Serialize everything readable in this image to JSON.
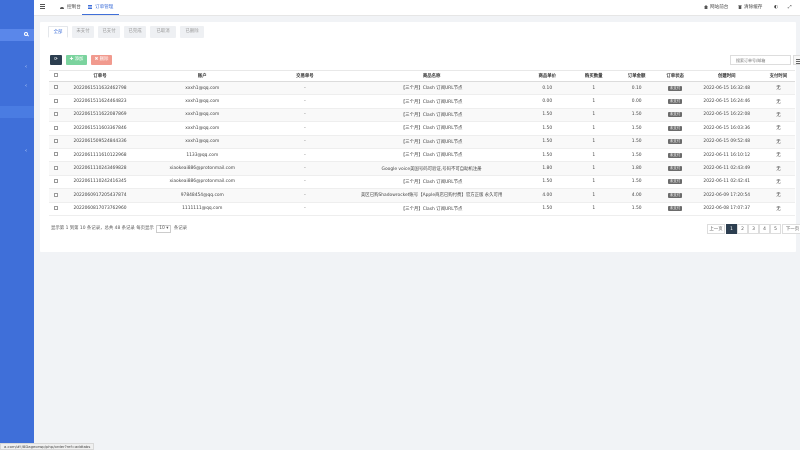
{
  "colors": {
    "sidebar": "#3f6fd9",
    "accent": "#3f6fd9",
    "dark": "#2c3e50",
    "add": "#7bd39e",
    "delete": "#f19a8e"
  },
  "topbar": {
    "tabs": [
      {
        "label": "控制台",
        "icon": "dashboard-icon"
      },
      {
        "label": "订单管理",
        "icon": "list-icon"
      }
    ],
    "right": [
      {
        "label": "网站前台",
        "icon": "home-icon"
      },
      {
        "label": "清除缓存",
        "icon": "trash-icon"
      }
    ]
  },
  "filter_tabs": [
    "全部",
    "未支付",
    "已支付",
    "已完成",
    "已取消",
    "已删除"
  ],
  "toolbar": {
    "add": "添加",
    "delete": "删除"
  },
  "search": {
    "placeholder": "搜索订单号/邮箱"
  },
  "table": {
    "headers": [
      "订单号",
      "账户",
      "交易单号",
      "商品名称",
      "商品单价",
      "购买数量",
      "订单金额",
      "订单状态",
      "创建时间",
      "支付时间"
    ],
    "rows": [
      [
        "2022061511632462798",
        "xxxh1@qq.com",
        "-",
        "【三个月】Clash 订阅URL节点",
        "0.10",
        "1",
        "0.10",
        "未支付",
        "2022-06-15 16:32:48",
        "无"
      ],
      [
        "2022061511624464823",
        "xxxh1@qq.com",
        "-",
        "【三个月】Clash 订阅URL节点",
        "0.00",
        "1",
        "0.00",
        "未支付",
        "2022-06-15 16:24:46",
        "无"
      ],
      [
        "2022061511622087869",
        "xxxh1@qq.com",
        "-",
        "【三个月】Clash 订阅URL节点",
        "1.50",
        "1",
        "1.50",
        "未支付",
        "2022-06-15 16:22:08",
        "无"
      ],
      [
        "2022061511603367846",
        "xxxh1@qq.com",
        "-",
        "【三个月】Clash 订阅URL节点",
        "1.50",
        "1",
        "1.50",
        "未支付",
        "2022-06-15 16:03:36",
        "无"
      ],
      [
        "2022061509524844336",
        "xxxh1@qq.com",
        "-",
        "【三个月】Clash 订阅URL节点",
        "1.50",
        "1",
        "1.50",
        "未支付",
        "2022-06-15 09:52:48",
        "无"
      ],
      [
        "2022061111610122968",
        "1133@qq.com",
        "-",
        "【三个月】Clash 订阅URL节点",
        "1.50",
        "1",
        "1.50",
        "未支付",
        "2022-06-11 16:10:12",
        "无"
      ],
      [
        "2022061110243469828",
        "xiaokeai886@protonmail.com",
        "-",
        "Google voice美国号码可验证,号码不可自助机注册",
        "1.80",
        "1",
        "1.80",
        "未支付",
        "2022-06-11 02:43:49",
        "无"
      ],
      [
        "2022061110242416345",
        "xiaokeai886@protonmail.com",
        "-",
        "【三个月】Clash 订阅URL节点",
        "1.50",
        "1",
        "1.50",
        "未支付",
        "2022-06-11 02:42:41",
        "无"
      ],
      [
        "2022060917205437874",
        "97848454@qq.com",
        "-",
        "美区已购Shadowrocket账号【Apple商店已购付费】官方正版 永久可用",
        "4.00",
        "1",
        "4.00",
        "未支付",
        "2022-06-09 17:20:54",
        "无"
      ],
      [
        "2022060817073762960",
        "1111111@qq.com",
        "-",
        "【三个月】Clash 订阅URL节点",
        "1.50",
        "1",
        "1.50",
        "未支付",
        "2022-06-08 17:07:37",
        "无"
      ]
    ]
  },
  "pagination": {
    "info_prefix": "显示第 1 到第 10 条记录，总共 48 条记录 每页显示",
    "per_page": "10",
    "info_suffix": "条记录",
    "prev": "上一页",
    "pages": [
      "1",
      "2",
      "3",
      "4",
      "5"
    ],
    "next": "下一页"
  },
  "statusbar": "a.com/#!/8Dageorwp/php/order?ref=addtabs"
}
